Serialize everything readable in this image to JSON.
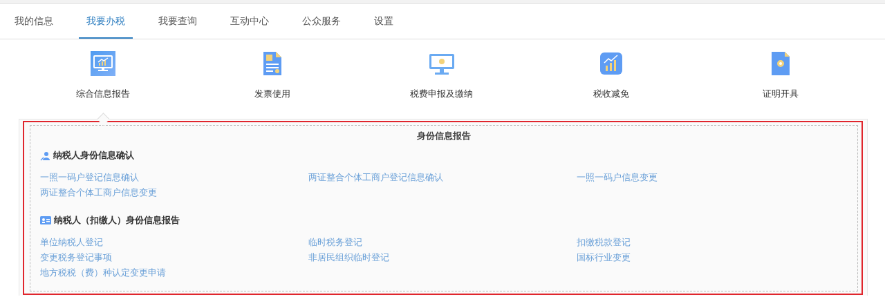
{
  "tabs": [
    {
      "label": "我的信息",
      "selected": false
    },
    {
      "label": "我要办税",
      "selected": true
    },
    {
      "label": "我要查询",
      "selected": false
    },
    {
      "label": "互动中心",
      "selected": false
    },
    {
      "label": "公众服务",
      "selected": false
    },
    {
      "label": "设置",
      "selected": false
    }
  ],
  "categories": [
    {
      "label": "综合信息报告",
      "selected": true
    },
    {
      "label": "发票使用",
      "selected": false
    },
    {
      "label": "税费申报及缴纳",
      "selected": false
    },
    {
      "label": "税收减免",
      "selected": false
    },
    {
      "label": "证明开具",
      "selected": false
    }
  ],
  "panel": {
    "title": "身份信息报告",
    "sections": [
      {
        "heading": "纳税人身份信息确认",
        "links": [
          "一照一码户登记信息确认",
          "两证整合个体工商户登记信息确认",
          "一照一码户信息变更",
          "两证整合个体工商户信息变更"
        ]
      },
      {
        "heading": "纳税人（扣缴人）身份信息报告",
        "links": [
          "单位纳税人登记",
          "临时税务登记",
          "扣缴税款登记",
          "变更税务登记事项",
          "非居民组织临时登记",
          "国标行业变更",
          "地方税税（费）种认定变更申请"
        ]
      }
    ]
  }
}
